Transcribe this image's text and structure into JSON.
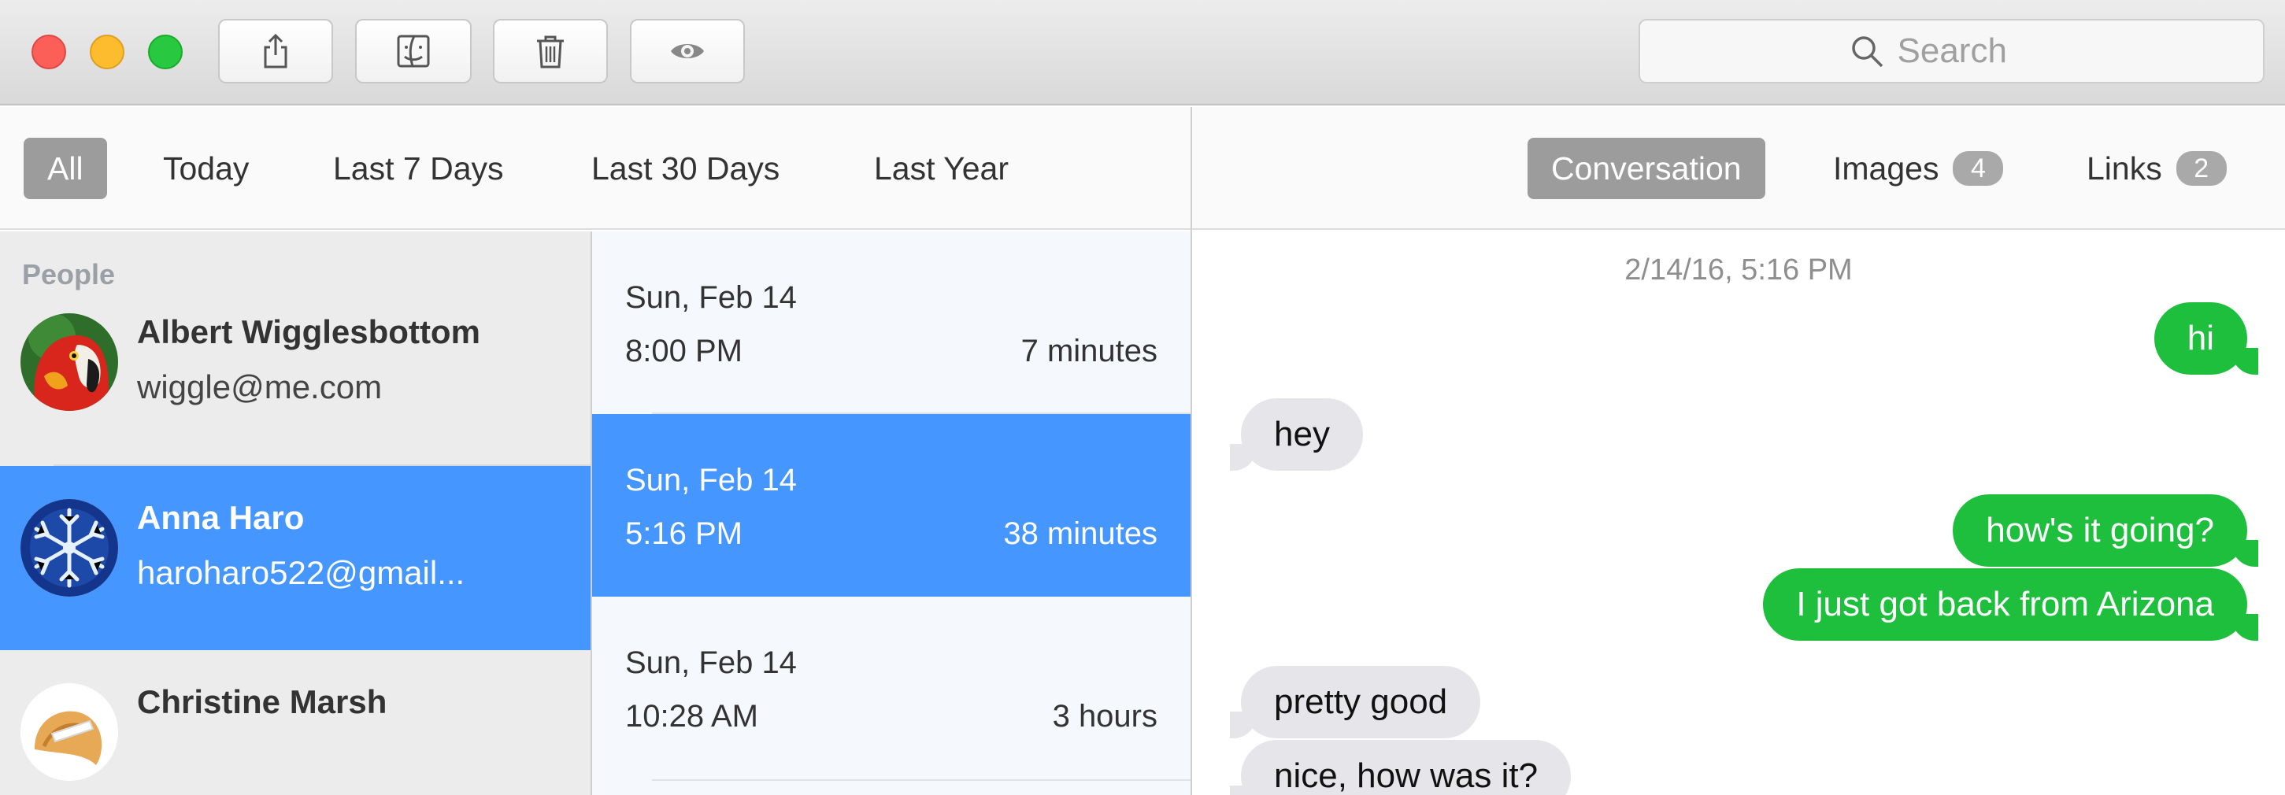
{
  "toolbar": {
    "share_icon": "share-icon",
    "finder_icon": "finder-icon",
    "trash_icon": "trash-icon",
    "eye_icon": "eye-icon"
  },
  "search": {
    "placeholder": "Search"
  },
  "filters": [
    {
      "label": "All",
      "active": true
    },
    {
      "label": "Today",
      "active": false
    },
    {
      "label": "Last 7 Days",
      "active": false
    },
    {
      "label": "Last 30 Days",
      "active": false
    },
    {
      "label": "Last Year",
      "active": false
    }
  ],
  "detail_tabs": [
    {
      "label": "Conversation",
      "active": true,
      "badge": null
    },
    {
      "label": "Images",
      "active": false,
      "badge": "4"
    },
    {
      "label": "Links",
      "active": false,
      "badge": "2"
    }
  ],
  "people": {
    "header": "People",
    "items": [
      {
        "name": "Albert Wigglesbottom",
        "email": "wiggle@me.com",
        "selected": false
      },
      {
        "name": "Anna Haro",
        "email": "haroharo522@gmail...",
        "selected": true
      },
      {
        "name": "Christine Marsh",
        "email": "",
        "selected": false
      }
    ]
  },
  "conversations": [
    {
      "date": "Sun, Feb 14",
      "time": "8:00 PM",
      "duration": "7 minutes",
      "selected": false
    },
    {
      "date": "Sun, Feb 14",
      "time": "5:16 PM",
      "duration": "38 minutes",
      "selected": true
    },
    {
      "date": "Sun, Feb 14",
      "time": "10:28 AM",
      "duration": "3 hours",
      "selected": false
    }
  ],
  "messages": {
    "timestamp": "2/14/16, 5:16 PM",
    "items": [
      {
        "text": "hi",
        "direction": "out"
      },
      {
        "text": "hey",
        "direction": "in"
      },
      {
        "text": "how's it going?",
        "direction": "out"
      },
      {
        "text": "I just got back from Arizona",
        "direction": "out"
      },
      {
        "text": "pretty good",
        "direction": "in"
      },
      {
        "text": "nice, how was it?",
        "direction": "in"
      }
    ]
  },
  "colors": {
    "selection_blue": "#4596ff",
    "outgoing_bubble": "#1fbf3e",
    "incoming_bubble": "#e5e5ea"
  }
}
